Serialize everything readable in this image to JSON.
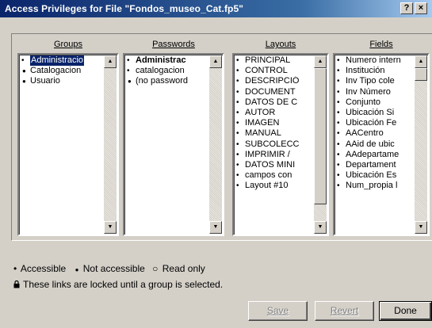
{
  "window": {
    "title": "Access Privileges for File \"Fondos_museo_Cat.fp5\"",
    "help_label": "?",
    "close_label": "×"
  },
  "columns": {
    "groups": {
      "header": "Groups",
      "items": [
        {
          "label": "Administracio",
          "bullet": "•",
          "state": "selected"
        },
        {
          "label": "Catalogacion",
          "bullet": "●",
          "state": "normal"
        },
        {
          "label": "Usuario",
          "bullet": "●",
          "state": "normal"
        }
      ]
    },
    "passwords": {
      "header": "Passwords",
      "items": [
        {
          "label": "Administrac",
          "bullet": "•",
          "state": "bold"
        },
        {
          "label": "catalogacion",
          "bullet": "•",
          "state": "normal"
        },
        {
          "label": "(no password",
          "bullet": "●",
          "state": "normal"
        }
      ]
    },
    "layouts": {
      "header": "Layouts",
      "items": [
        {
          "label": "PRINCIPAL",
          "bullet": "•"
        },
        {
          "label": "CONTROL",
          "bullet": "•"
        },
        {
          "label": "DESCRIPCIÓ",
          "bullet": "•"
        },
        {
          "label": "DOCUMENT",
          "bullet": "•"
        },
        {
          "label": "DATOS DE C",
          "bullet": "•"
        },
        {
          "label": "AUTOR",
          "bullet": "•"
        },
        {
          "label": "IMAGEN",
          "bullet": "•"
        },
        {
          "label": "MANUAL",
          "bullet": "•"
        },
        {
          "label": "SUBCOLECC",
          "bullet": "•"
        },
        {
          "label": "IMPRIMIR /",
          "bullet": "•"
        },
        {
          "label": "DATOS MINI",
          "bullet": "•"
        },
        {
          "label": "campos con",
          "bullet": "•"
        },
        {
          "label": "Layout #10",
          "bullet": "•"
        }
      ]
    },
    "fields": {
      "header": "Fields",
      "items": [
        {
          "label": "Numero intern",
          "bullet": "•"
        },
        {
          "label": "Institución",
          "bullet": "•"
        },
        {
          "label": "Inv Tipo cole",
          "bullet": "•"
        },
        {
          "label": "Inv Número",
          "bullet": "•"
        },
        {
          "label": "Conjunto",
          "bullet": "•"
        },
        {
          "label": "Ubicación Si",
          "bullet": "•"
        },
        {
          "label": "Ubicación Fe",
          "bullet": "•"
        },
        {
          "label": "AACentro",
          "bullet": "•"
        },
        {
          "label": "AAid de ubic",
          "bullet": "•"
        },
        {
          "label": "AAdepartame",
          "bullet": "•"
        },
        {
          "label": "Departament",
          "bullet": "•"
        },
        {
          "label": "Ubicación Es",
          "bullet": "•"
        },
        {
          "label": "Num_propia l",
          "bullet": "•"
        }
      ]
    }
  },
  "legend": {
    "accessible_bullet": "•",
    "accessible": "Accessible",
    "not_accessible_bullet": "●",
    "not_accessible": "Not accessible",
    "read_only_bullet": "○",
    "read_only": "Read only"
  },
  "lock_icon": "lock-icon",
  "lock_message": "These links are locked until a group is selected.",
  "buttons": {
    "save": "Save",
    "revert": "Revert",
    "done": "Done"
  },
  "colors": {
    "selection": "#0a246a",
    "dialog": "#d4d0c8"
  }
}
